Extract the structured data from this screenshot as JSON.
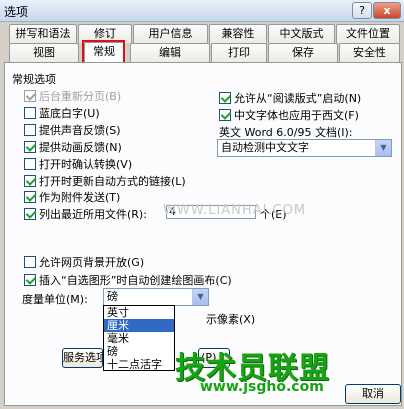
{
  "window": {
    "title": "选项",
    "help_label": "?",
    "close_label": "x"
  },
  "tabs_row1": [
    {
      "label": "拼写和语法"
    },
    {
      "label": "修订"
    },
    {
      "label": "用户信息"
    },
    {
      "label": "兼容性"
    },
    {
      "label": "中文版式"
    },
    {
      "label": "文件位置"
    }
  ],
  "tabs_row2": [
    {
      "label": "视图"
    },
    {
      "label": "常规",
      "active": true
    },
    {
      "label": "编辑"
    },
    {
      "label": "打印"
    },
    {
      "label": "保存"
    },
    {
      "label": "安全性"
    }
  ],
  "general": {
    "group_label": "常规选项",
    "left_options": [
      {
        "label": "后台重新分页(B)",
        "checked": true,
        "disabled": true
      },
      {
        "label": "蓝底白字(U)",
        "checked": false
      },
      {
        "label": "提供声音反馈(S)",
        "checked": false
      },
      {
        "label": "提供动画反馈(N)",
        "checked": true
      },
      {
        "label": "打开时确认转换(V)",
        "checked": false
      },
      {
        "label": "打开时更新自动方式的链接(L)",
        "checked": true
      },
      {
        "label": "作为附件发送(T)",
        "checked": true
      },
      {
        "label": "列出最近所用文件(R):",
        "checked": true
      }
    ],
    "recent_files_count": "4",
    "recent_files_unit": "个(E)",
    "right_options": [
      {
        "label": "允许从“阅读版式”启动(N)",
        "checked": true
      },
      {
        "label": "中文字体也应用于西文(F)",
        "checked": true
      }
    ],
    "word_doc_label": "英文 Word 6.0/95 文档(I):",
    "word_doc_value": "自动检测中文文字",
    "allow_bg_label": "允许网页背景开放(G)",
    "allow_bg_checked": false,
    "insert_shape_label": "插入“自选图形”时自动创建绘图画布(C)",
    "insert_shape_checked": true,
    "unit_label": "度量单位(M):",
    "unit_value": "磅",
    "unit_options": [
      "英寸",
      "厘米",
      "毫米",
      "磅",
      "十二点活字"
    ],
    "unit_selected_index": 1,
    "pixels_label": "示像素(X)",
    "service_button_label": "服务选项(V)...",
    "web_button_label": "(P)...",
    "cancel_label": "取消"
  },
  "watermarks": {
    "row_text": "WWW.LIANHAI.COM",
    "brand_text": "技术员联盟",
    "brand_url": "www.jsgho.com"
  }
}
